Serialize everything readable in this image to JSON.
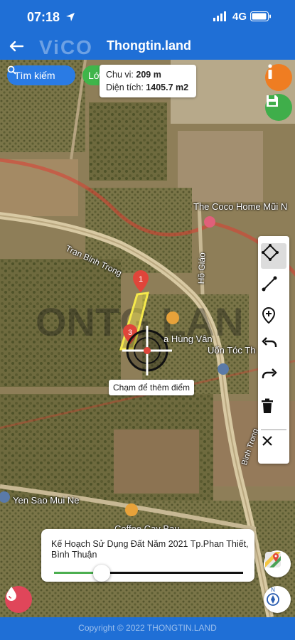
{
  "status": {
    "time": "07:18",
    "network": "4G"
  },
  "header": {
    "logo_text": "ViCO",
    "title": "Thongtin.land"
  },
  "map": {
    "search_label": "Tìm kiếm",
    "layer_chip_label": "Lớ",
    "measure": {
      "perimeter_label": "Chu vi:",
      "perimeter_value": "209 m",
      "area_label": "Diện tích:",
      "area_value": "1405.7 m2"
    },
    "streets": [
      "Tran Binh Trong",
      "Hồ Giáo",
      "Binh Trong"
    ],
    "places": [
      "The Coco Home Mũi N",
      "Uốn Tóc Th",
      "Yen Sao Mui Ne",
      "Coffee Cay Bau",
      "a Hùng Vân"
    ],
    "watermark": "ONTG LAN",
    "markers": [
      "1",
      "3"
    ],
    "tap_hint": "Chạm để thêm điểm",
    "plan": {
      "title": "Kế Hoạch Sử Dụng Đất Năm 2021 Tp.Phan Thiết, Bình Thuận",
      "opacity": 0.25
    }
  },
  "toolbar": {
    "tools": [
      "polygon-draw-icon",
      "line-measure-icon",
      "add-point-icon",
      "undo-icon",
      "redo-icon",
      "delete-icon",
      "close-icon"
    ]
  },
  "footer": {
    "copyright": "Copyright © 2022 THONGTIN.LAND"
  },
  "colors": {
    "brand_blue": "#1f6fd6",
    "info_orange": "#ef7d22",
    "save_green": "#3fae4a",
    "parcel_yellow": "#f5e94b"
  }
}
